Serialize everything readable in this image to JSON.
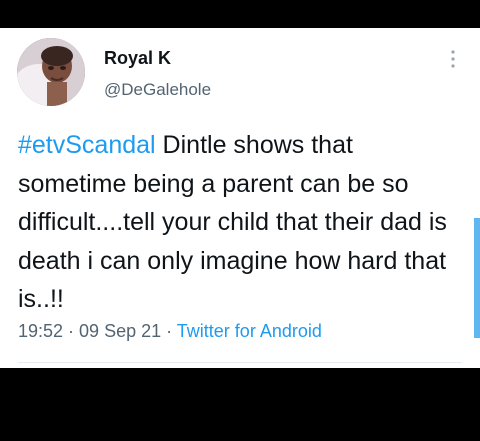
{
  "tweet": {
    "author": {
      "display_name": "Royal K",
      "handle": "@DeGalehole"
    },
    "text": {
      "hashtag": "#etvScandal",
      "body": " Dintle shows that sometime being a parent can be so difficult....tell your child that their dad is death i can only imagine how hard that is..!!"
    },
    "meta": {
      "time": "19:52",
      "separator_1": " · ",
      "date": "09 Sep 21",
      "separator_2": " · ",
      "source": "Twitter for Android"
    }
  },
  "icons": {
    "more": "more-options-icon",
    "avatar": "profile-photo"
  },
  "colors": {
    "link": "#1d9bf0",
    "text": "#0f1419",
    "muted": "#536471"
  }
}
